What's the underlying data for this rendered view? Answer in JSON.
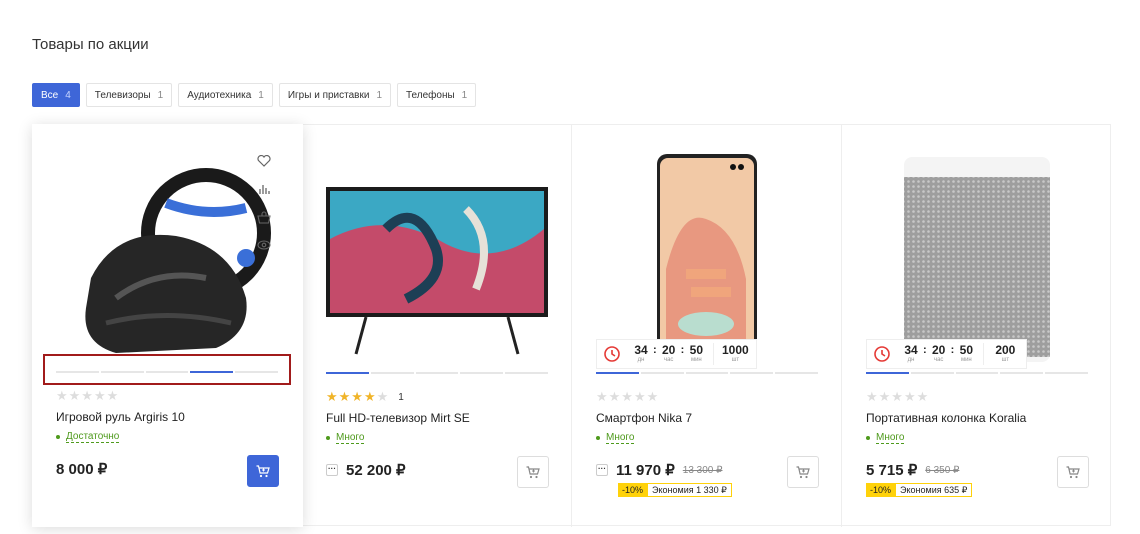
{
  "title": "Товары по акции",
  "tabs": [
    {
      "label": "Все",
      "count": "4"
    },
    {
      "label": "Телевизоры",
      "count": "1"
    },
    {
      "label": "Аудиотехника",
      "count": "1"
    },
    {
      "label": "Игры и приставки",
      "count": "1"
    },
    {
      "label": "Телефоны",
      "count": "1"
    }
  ],
  "products": [
    {
      "name": "Игровой руль Argiris 10",
      "stock": "Достаточно",
      "price": "8 000 ₽",
      "rating": 0,
      "rating_count": ""
    },
    {
      "name": "Full HD-телевизор Mirt SE",
      "stock": "Много",
      "price": "52 200 ₽",
      "more": "···",
      "rating": 4,
      "rating_count": "1"
    },
    {
      "name": "Смартфон Nika 7",
      "stock": "Много",
      "price": "11 970 ₽",
      "old_price": "13 300 ₽",
      "more": "···",
      "discount": "-10%",
      "savings": "Экономия 1 330 ₽",
      "rating": 0,
      "timer": {
        "days": "34",
        "hours": "20",
        "mins": "50",
        "qty": "1000",
        "days_label": "дн",
        "hours_label": "час",
        "mins_label": "мин",
        "qty_label": "шт"
      }
    },
    {
      "name": "Портативная колонка Koralia",
      "stock": "Много",
      "price": "5 715 ₽",
      "old_price": "6 350 ₽",
      "discount": "-10%",
      "savings": "Экономия 635 ₽",
      "rating": 0,
      "timer": {
        "days": "34",
        "hours": "20",
        "mins": "50",
        "qty": "200",
        "days_label": "дн",
        "hours_label": "час",
        "mins_label": "мин",
        "qty_label": "шт"
      }
    }
  ],
  "colors": {
    "accent": "#3e66d8",
    "stock": "#4e9a1c",
    "promo": "#ffd20a",
    "star": "#f0b429"
  },
  "icons": [
    "heart-icon",
    "compare-icon",
    "buy-one-click-icon",
    "quick-view-icon",
    "cart-icon",
    "clock-icon"
  ]
}
